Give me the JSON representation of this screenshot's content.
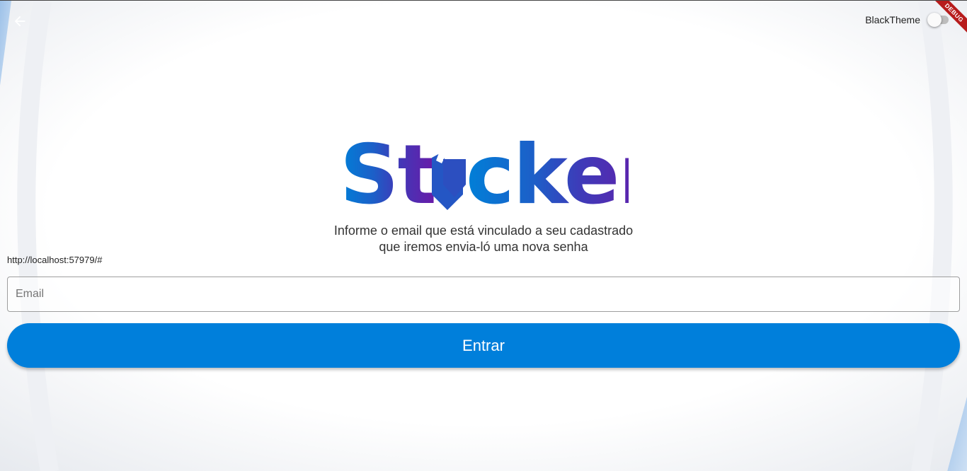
{
  "header": {
    "back_icon": "arrow-left-icon",
    "theme_toggle_label": "BlackTheme",
    "theme_toggle_on": false,
    "debug_banner": "DEBUG"
  },
  "logo": {
    "text_prefix": "St",
    "text_suffix": "cker",
    "icon": "shirt-badge-icon",
    "colors": {
      "blue": "#0080d8",
      "purple": "#6a1aa8"
    }
  },
  "main": {
    "subtitle_line1": "Informe o email que está vinculado a seu cadastrado",
    "subtitle_line2": "que iremos envia-ló uma nova senha",
    "url_text": "http://localhost:57979/#",
    "email_placeholder": "Email",
    "email_value": "",
    "submit_label": "Entrar"
  },
  "colors": {
    "primary": "#007fdb",
    "background": "#ffffff"
  }
}
